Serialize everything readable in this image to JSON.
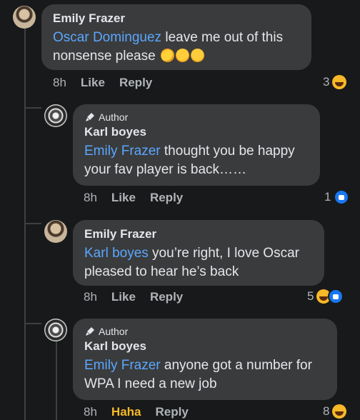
{
  "comments": [
    {
      "author": "Emily Frazer",
      "badge": "",
      "mention": "Oscar Dominguez",
      "text": " leave me out of this nonsense please ",
      "emojis": [
        "sweat-smile-emoji",
        "hug-emoji",
        "hug-emoji"
      ],
      "time": "8h",
      "like_label": "Like",
      "reply_label": "Reply",
      "reaction_count": "3",
      "reactions": [
        "haha"
      ]
    },
    {
      "author": "Karl boyes",
      "badge": "Author",
      "mention": "Emily Frazer",
      "text": " thought you be happy your fav player is back……",
      "time": "8h",
      "like_label": "Like",
      "reply_label": "Reply",
      "reaction_count": "1",
      "reactions": [
        "like"
      ]
    },
    {
      "author": "Emily Frazer",
      "badge": "",
      "mention": "Karl boyes",
      "text": " you’re right, I love Oscar pleased to hear he’s back",
      "time": "8h",
      "like_label": "Like",
      "reply_label": "Reply",
      "reaction_count": "5",
      "reactions": [
        "haha",
        "like"
      ]
    },
    {
      "author": "Karl boyes",
      "badge": "Author",
      "mention": "Emily Frazer",
      "text": " anyone got a number for WPA I need a new job",
      "time": "8h",
      "like_label": "Haha",
      "reply_label": "Reply",
      "reaction_count": "8",
      "reactions": [
        "haha"
      ]
    }
  ],
  "colors": {
    "background": "#18191a",
    "bubble": "#3a3b3c",
    "mention": "#5aa7ff",
    "haha_active": "#f7b928",
    "like_blue": "#1877f2"
  }
}
